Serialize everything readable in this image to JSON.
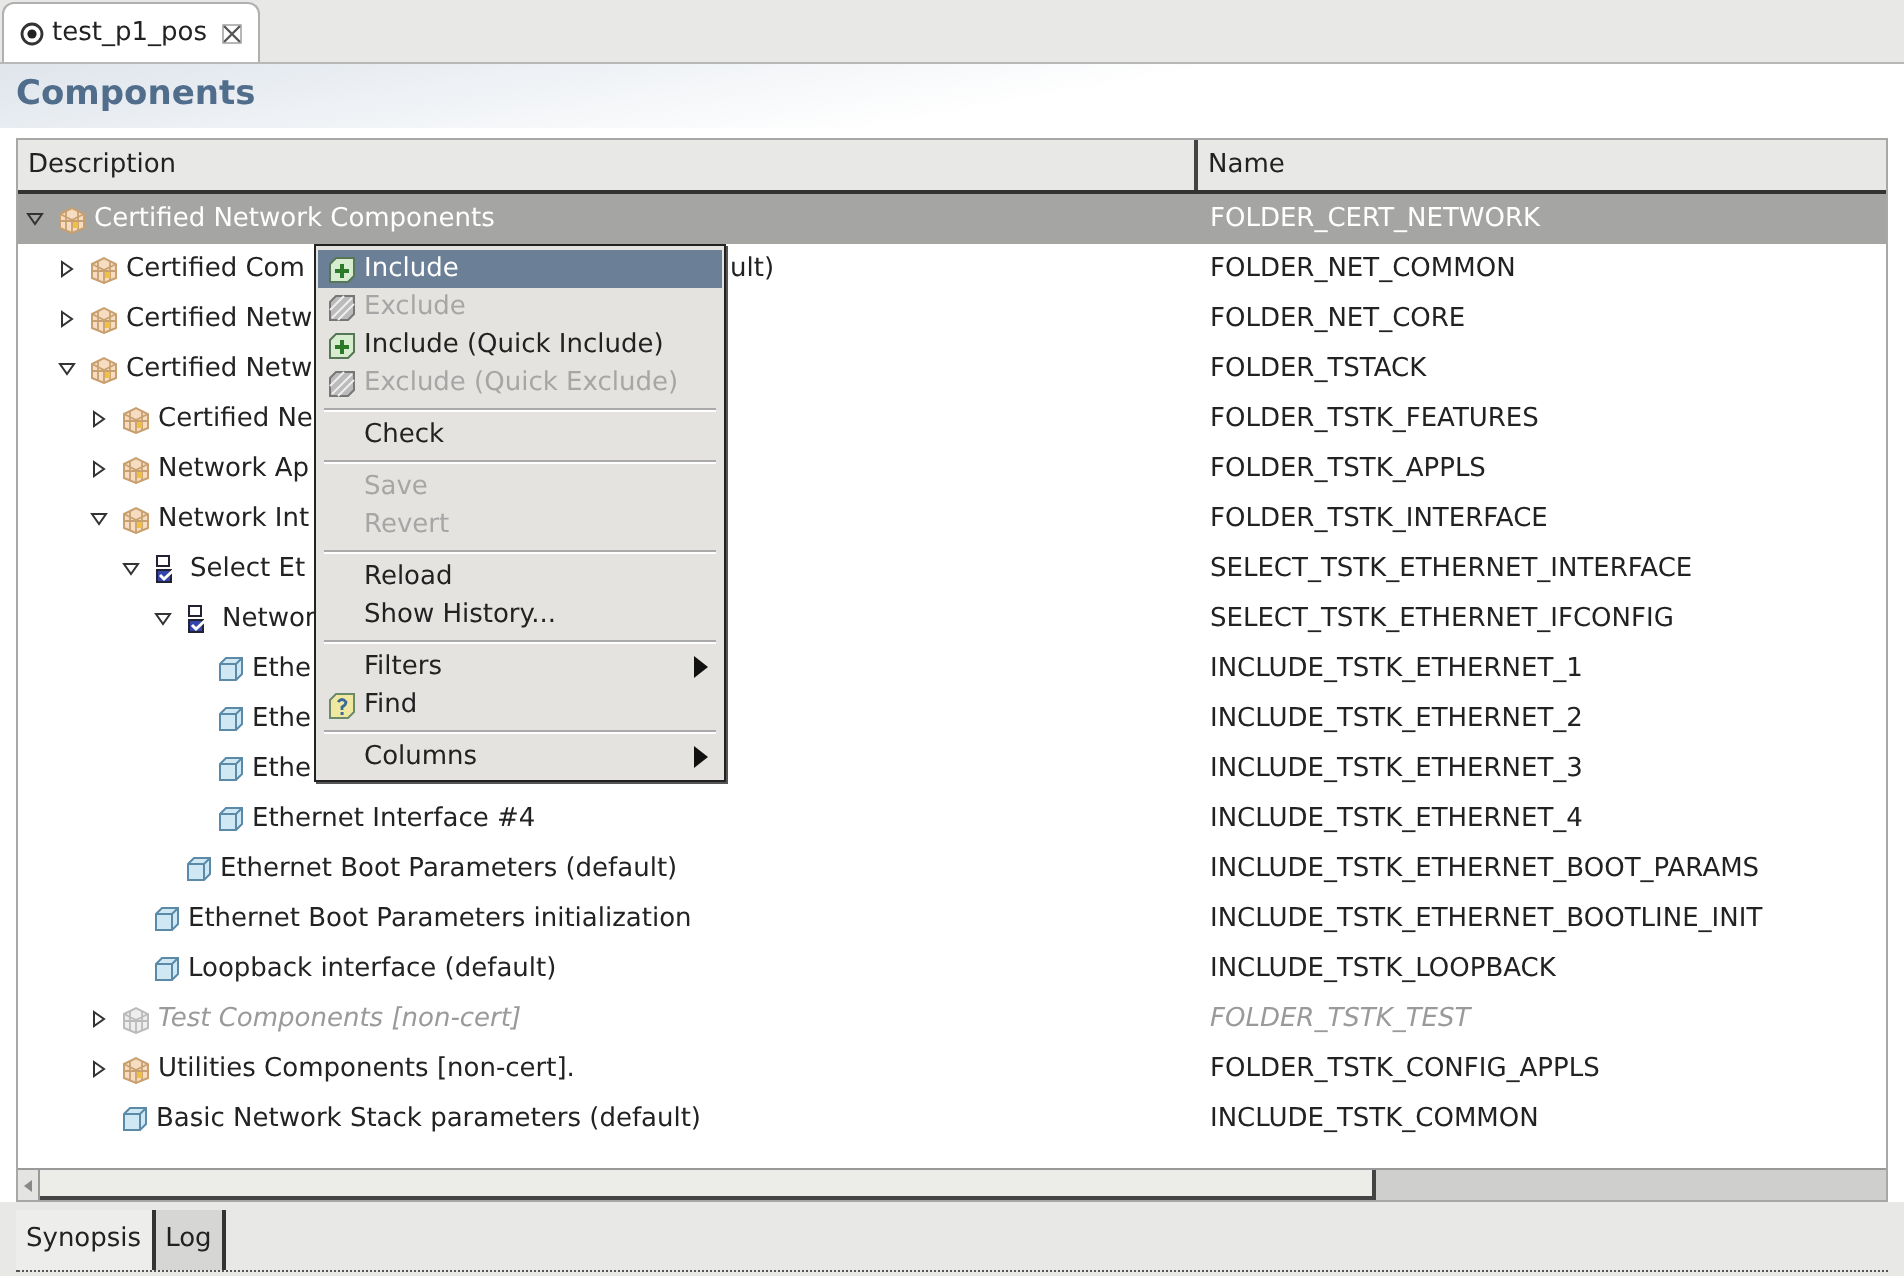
{
  "editor_tab": {
    "title": "test_p1_pos",
    "selected": true
  },
  "section_title": "Components",
  "table": {
    "columns": [
      "Description",
      "Name"
    ],
    "rows": [
      {
        "description": "Certified Network Components",
        "name": "FOLDER_CERT_NETWORK",
        "kind": "folder",
        "expanded": true,
        "selected": true,
        "disabled": false,
        "children": [
          {
            "description": "Certified Com",
            "description_tail": "ult)",
            "name": "FOLDER_NET_COMMON",
            "kind": "folder",
            "expanded": false,
            "selected": false,
            "disabled": false
          },
          {
            "description": "Certified Netw",
            "name": "FOLDER_NET_CORE",
            "kind": "folder",
            "expanded": false,
            "selected": false,
            "disabled": false
          },
          {
            "description": "Certified Netw",
            "name": "FOLDER_TSTACK",
            "kind": "folder",
            "expanded": true,
            "selected": false,
            "disabled": false,
            "children": [
              {
                "description": "Certified Ne",
                "name": "FOLDER_TSTK_FEATURES",
                "kind": "folder",
                "expanded": false,
                "selected": false,
                "disabled": false
              },
              {
                "description": "Network Ap",
                "name": "FOLDER_TSTK_APPLS",
                "kind": "folder",
                "expanded": false,
                "selected": false,
                "disabled": false
              },
              {
                "description": "Network Int",
                "name": "FOLDER_TSTK_INTERFACE",
                "kind": "folder",
                "expanded": true,
                "selected": false,
                "disabled": false,
                "children": [
                  {
                    "description": "Select Et",
                    "name": "SELECT_TSTK_ETHERNET_INTERFACE",
                    "kind": "selector",
                    "expanded": true,
                    "selected": false,
                    "disabled": false,
                    "children": [
                      {
                        "description": "Networ",
                        "name": "SELECT_TSTK_ETHERNET_IFCONFIG",
                        "kind": "selector",
                        "expanded": true,
                        "selected": false,
                        "disabled": false,
                        "children": [
                          {
                            "description": "Ethe",
                            "name": "INCLUDE_TSTK_ETHERNET_1",
                            "kind": "component",
                            "selected": false,
                            "disabled": false
                          },
                          {
                            "description": "Ethe",
                            "name": "INCLUDE_TSTK_ETHERNET_2",
                            "kind": "component",
                            "selected": false,
                            "disabled": false
                          },
                          {
                            "description": "Ethe",
                            "name": "INCLUDE_TSTK_ETHERNET_3",
                            "kind": "component",
                            "selected": false,
                            "disabled": false
                          },
                          {
                            "description": "Ethernet Interface #4",
                            "name": "INCLUDE_TSTK_ETHERNET_4",
                            "kind": "component",
                            "selected": false,
                            "disabled": false
                          }
                        ]
                      },
                      {
                        "description": "Ethernet Boot Parameters (default)",
                        "name": "INCLUDE_TSTK_ETHERNET_BOOT_PARAMS",
                        "kind": "component",
                        "selected": false,
                        "disabled": false
                      }
                    ]
                  },
                  {
                    "description": "Ethernet Boot Parameters initialization",
                    "name": "INCLUDE_TSTK_ETHERNET_BOOTLINE_INIT",
                    "kind": "component",
                    "selected": false,
                    "disabled": false
                  },
                  {
                    "description": "Loopback interface (default)",
                    "name": "INCLUDE_TSTK_LOOPBACK",
                    "kind": "component",
                    "selected": false,
                    "disabled": false
                  }
                ]
              },
              {
                "description": "Test Components [non-cert]",
                "name": "FOLDER_TSTK_TEST",
                "kind": "folder",
                "expanded": false,
                "selected": false,
                "disabled": true
              },
              {
                "description": "Utilities Components [non-cert].",
                "name": "FOLDER_TSTK_CONFIG_APPLS",
                "kind": "folder",
                "expanded": false,
                "selected": false,
                "disabled": false
              },
              {
                "description": "Basic Network Stack parameters (default)",
                "name": "INCLUDE_TSTK_COMMON",
                "kind": "component",
                "selected": false,
                "disabled": false
              }
            ]
          }
        ]
      }
    ]
  },
  "context_menu": {
    "items": [
      {
        "kind": "include",
        "label": "Include",
        "selected": true,
        "disabled": false
      },
      {
        "kind": "exclude",
        "label": "Exclude",
        "selected": false,
        "disabled": true
      },
      {
        "kind": "include",
        "label": "Include (Quick Include)",
        "selected": false,
        "disabled": false
      },
      {
        "kind": "exclude",
        "label": "Exclude (Quick Exclude)",
        "selected": false,
        "disabled": true
      },
      {
        "kind": "separator"
      },
      {
        "kind": "plain",
        "label": "Check",
        "selected": false,
        "disabled": false
      },
      {
        "kind": "separator"
      },
      {
        "kind": "plain",
        "label": "Save",
        "selected": false,
        "disabled": true
      },
      {
        "kind": "plain",
        "label": "Revert",
        "selected": false,
        "disabled": true
      },
      {
        "kind": "separator"
      },
      {
        "kind": "plain",
        "label": "Reload",
        "selected": false,
        "disabled": false
      },
      {
        "kind": "plain",
        "label": "Show History...",
        "selected": false,
        "disabled": false
      },
      {
        "kind": "separator"
      },
      {
        "kind": "submenu",
        "label": "Filters",
        "selected": false,
        "disabled": false
      },
      {
        "kind": "find",
        "label": "Find",
        "selected": false,
        "disabled": false
      },
      {
        "kind": "separator"
      },
      {
        "kind": "submenu",
        "label": "Columns",
        "selected": false,
        "disabled": false
      }
    ]
  },
  "bottom_tabs": [
    {
      "label": "Synopsis",
      "selected": true
    },
    {
      "label": "Log",
      "selected": false
    }
  ]
}
